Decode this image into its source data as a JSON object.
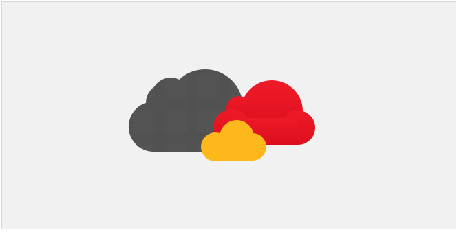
{
  "illustration": {
    "clouds": [
      {
        "name": "dark-cloud",
        "color": "#515151"
      },
      {
        "name": "red-cloud",
        "color": "#e8101f"
      },
      {
        "name": "yellow-cloud",
        "color": "#ffb81c"
      }
    ],
    "background_color": "#f1f1f1",
    "border_color": "#d6d6d6"
  }
}
